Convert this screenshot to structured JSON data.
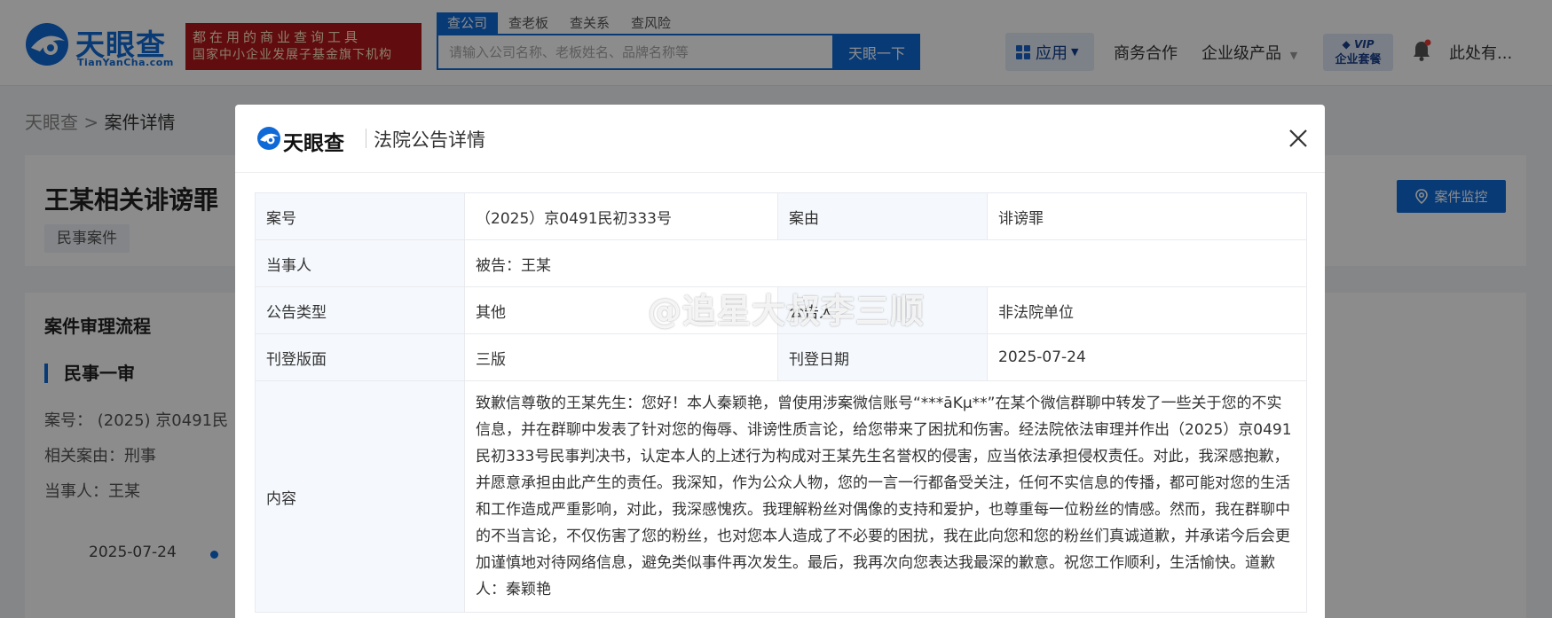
{
  "header": {
    "logo_text": "天眼查",
    "logo_sub": "TianYanCha.com",
    "slogan_line1": "都在用的商业查询工具",
    "slogan_line2": "国家中小企业发展子基金旗下机构",
    "search_tabs": [
      {
        "label": "查公司",
        "active": true
      },
      {
        "label": "查老板",
        "active": false
      },
      {
        "label": "查关系",
        "active": false
      },
      {
        "label": "查风险",
        "active": false
      }
    ],
    "search_placeholder": "请输入公司名称、老板姓名、品牌名称等",
    "search_button": "天眼一下",
    "nav_app": "应用",
    "nav_business": "商务合作",
    "nav_enterprise": "企业级产品",
    "vip_line1": "VIP",
    "vip_line2": "企业套餐",
    "user_name": "此处有..."
  },
  "breadcrumb": {
    "home": "天眼查",
    "separator": ">",
    "current": "案件详情"
  },
  "case": {
    "title": "王某相关诽谤罪",
    "tag": "民事案件",
    "monitor_button": "案件监控"
  },
  "process": {
    "title": "案件审理流程",
    "stage": "民事一审",
    "case_no": "案号： (2025) 京0491民",
    "related_cause": "相关案由：刑事",
    "party": "当事人：王某",
    "timeline_date": "2025-07-24"
  },
  "modal": {
    "logo_text": "天眼查",
    "title": "法院公告详情",
    "rows": {
      "case_no_label": "案号",
      "case_no_value": "（2025）京0491民初333号",
      "cause_label": "案由",
      "cause_value": "诽谤罪",
      "party_label": "当事人",
      "party_value": "被告：王某",
      "type_label": "公告类型",
      "type_value": "其他",
      "announcer_label": "公告人",
      "announcer_value": "非法院单位",
      "page_label": "刊登版面",
      "page_value": "三版",
      "date_label": "刊登日期",
      "date_value": "2025-07-24",
      "content_label": "内容",
      "content_value": "致歉信尊敬的王某先生：您好！本人秦颖艳，曾使用涉案微信账号“***āKμ**”在某个微信群聊中转发了一些关于您的不实信息，并在群聊中发表了针对您的侮辱、诽谤性质言论，给您带来了困扰和伤害。经法院依法审理并作出（2025）京0491民初333号民事判决书，认定本人的上述行为构成对王某先生名誉权的侵害，应当依法承担侵权责任。对此，我深感抱歉，并愿意承担由此产生的责任。我深知，作为公众人物，您的一言一行都备受关注，任何不实信息的传播，都可能对您的生活和工作造成严重影响，对此，我深感愧疚。我理解粉丝对偶像的支持和爱护，也尊重每一位粉丝的情感。然而，我在群聊中的不当言论，不仅伤害了您的粉丝，也对您本人造成了不必要的困扰，我在此向您和您的粉丝们真诚道歉，并承诺今后会更加谨慎地对待网络信息，避免类似事件再次发生。最后，我再次向您表达我最深的歉意。祝您工作顺利，生活愉快。道歉人：秦颖艳"
    }
  },
  "watermark": "@追星大叔李三顺",
  "colors": {
    "brand_blue": "#0f6ad8",
    "slogan_red": "#b1161c"
  }
}
